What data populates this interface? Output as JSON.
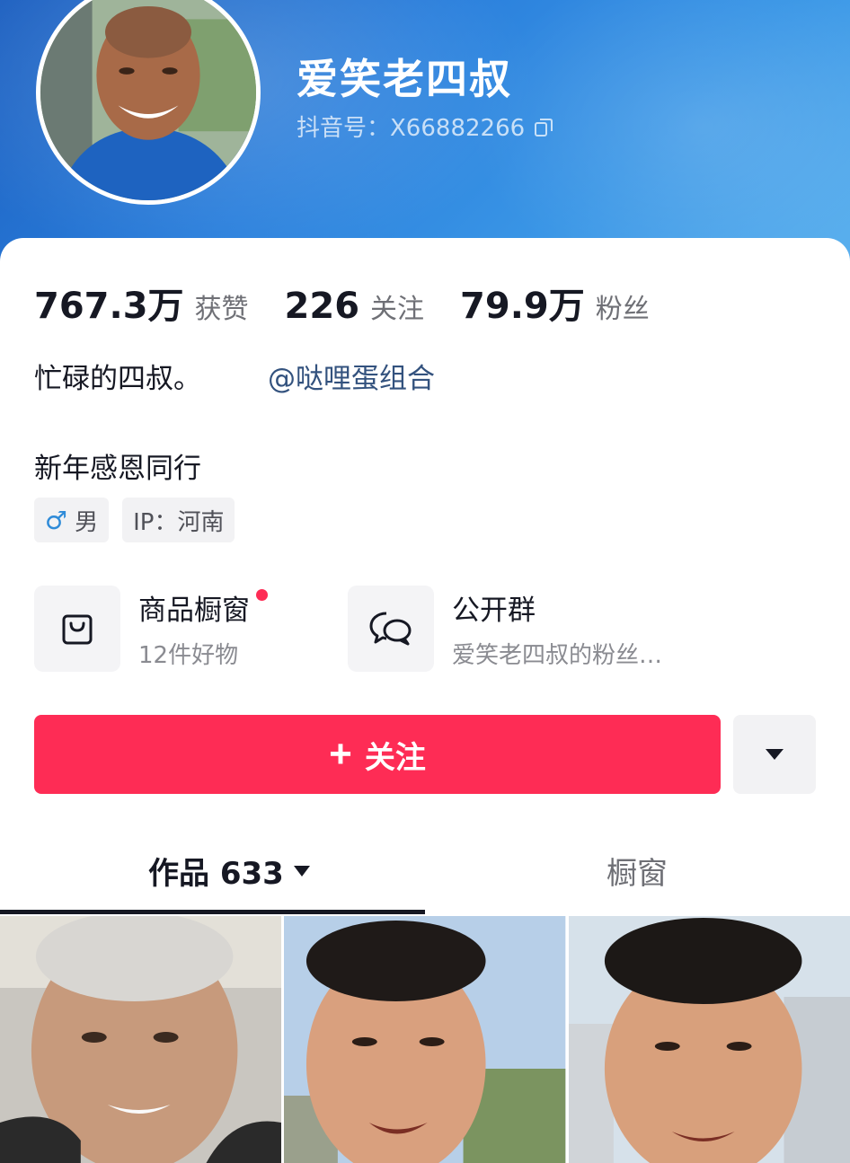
{
  "profile": {
    "nickname": "爱笑老四叔",
    "account_id": "抖音号：X66882266"
  },
  "stats": [
    {
      "value": "767.3万",
      "label": "获赞"
    },
    {
      "value": "226",
      "label": "关注"
    },
    {
      "value": "79.9万",
      "label": "粉丝"
    }
  ],
  "bio": {
    "line1": "忙碌的四叔。",
    "mention": "@哒哩蛋组合",
    "signature": "新年感恩同行"
  },
  "tags": {
    "gender": "男",
    "ip": "IP：河南"
  },
  "features": {
    "shop": {
      "title": "商品橱窗",
      "subtitle": "12件好物"
    },
    "group": {
      "title": "公开群",
      "subtitle": "爱笑老四叔的粉丝…"
    }
  },
  "actions": {
    "follow_label": "关注"
  },
  "tabs": {
    "works": "作品 633",
    "shop": "橱窗"
  },
  "colors": {
    "accent": "#fe2c55",
    "header": "#2a7fdc",
    "mention": "#33527e"
  },
  "icons": [
    "copy-icon",
    "male-icon",
    "shopping-bag-icon",
    "chat-group-icon",
    "plus-icon",
    "caret-down-icon"
  ]
}
